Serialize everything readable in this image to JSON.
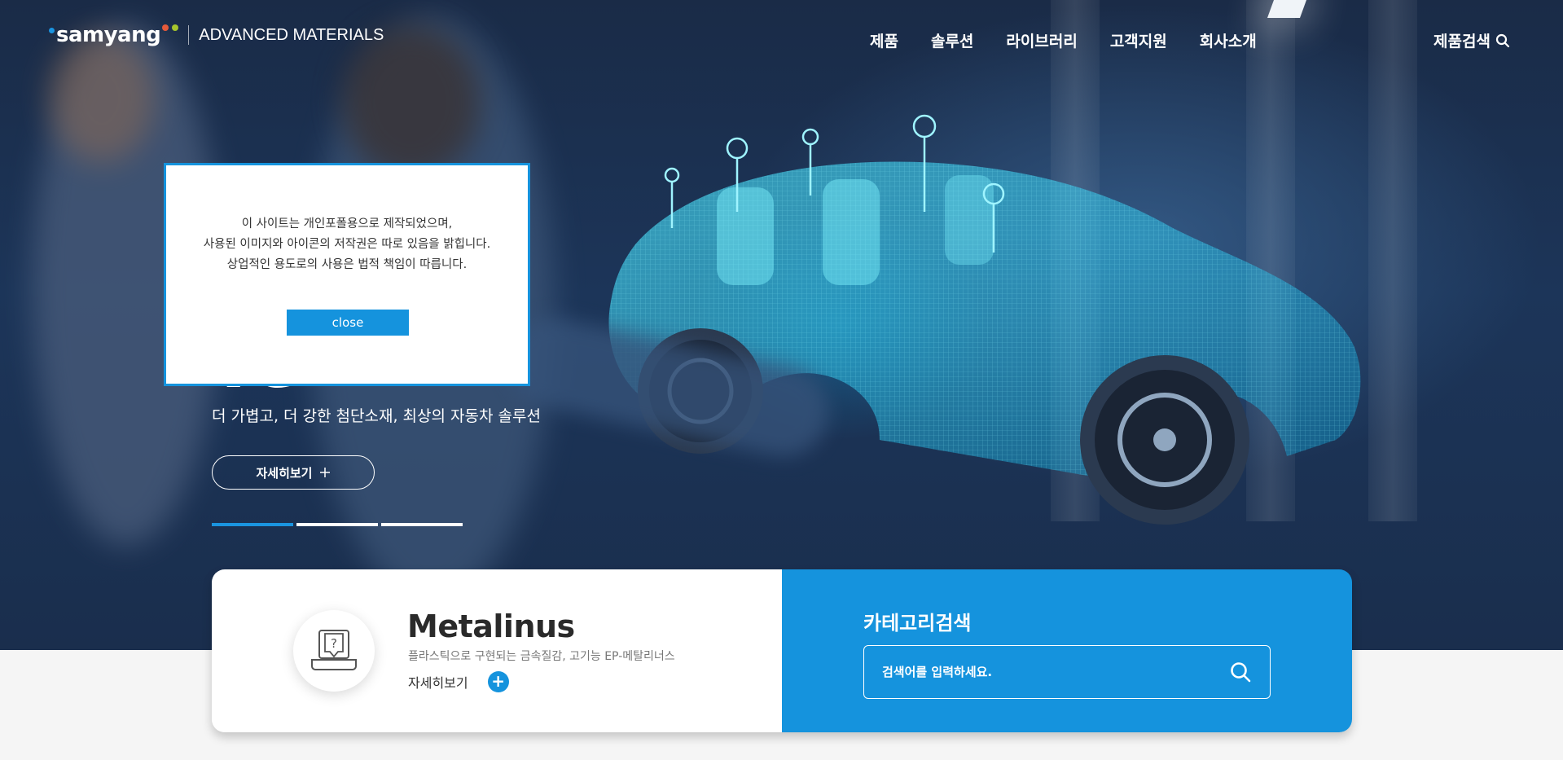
{
  "nav": {
    "logo_word": "samyang",
    "logo_sub": "ADVANCED MATERIALS",
    "logo_dot_colors": [
      "#1a94e0",
      "#e65a3a",
      "#a6c52c"
    ],
    "menu": [
      "제품",
      "솔루션",
      "라이브러리",
      "고객지원",
      "회사소개"
    ],
    "search_label": "제품검색",
    "search_icon": "search-icon"
  },
  "hero": {
    "title_visible": "ve",
    "subtitle": "더 가볍고, 더 강한 첨단소재, 최상의 자동차 솔루션",
    "more_label": "자세히보기",
    "more_icon": "plus-icon",
    "pager_count": 3,
    "pager_active_index": 0
  },
  "popup": {
    "lines": [
      "이 사이트는 개인포폴용으로 제작되었으며,",
      "사용된 이미지와 아이콘의 저작권은 따로 있음을 밝힙니다.",
      "상업적인 용도로의 사용은 법적 책임이 따릅니다."
    ],
    "close_label": "close"
  },
  "product": {
    "icon": "laptop-question-icon",
    "title": "Metalinus",
    "description": "플라스틱으로 구현되는 금속질감, 고기능 EP-메탈리너스",
    "more_label": "자세히보기",
    "more_icon": "+"
  },
  "category_search": {
    "title": "카테고리검색",
    "placeholder": "검색어를 입력하세요.",
    "search_icon": "search-icon"
  },
  "colors": {
    "accent": "#1593dd",
    "hero_bg": "#1c3559"
  }
}
